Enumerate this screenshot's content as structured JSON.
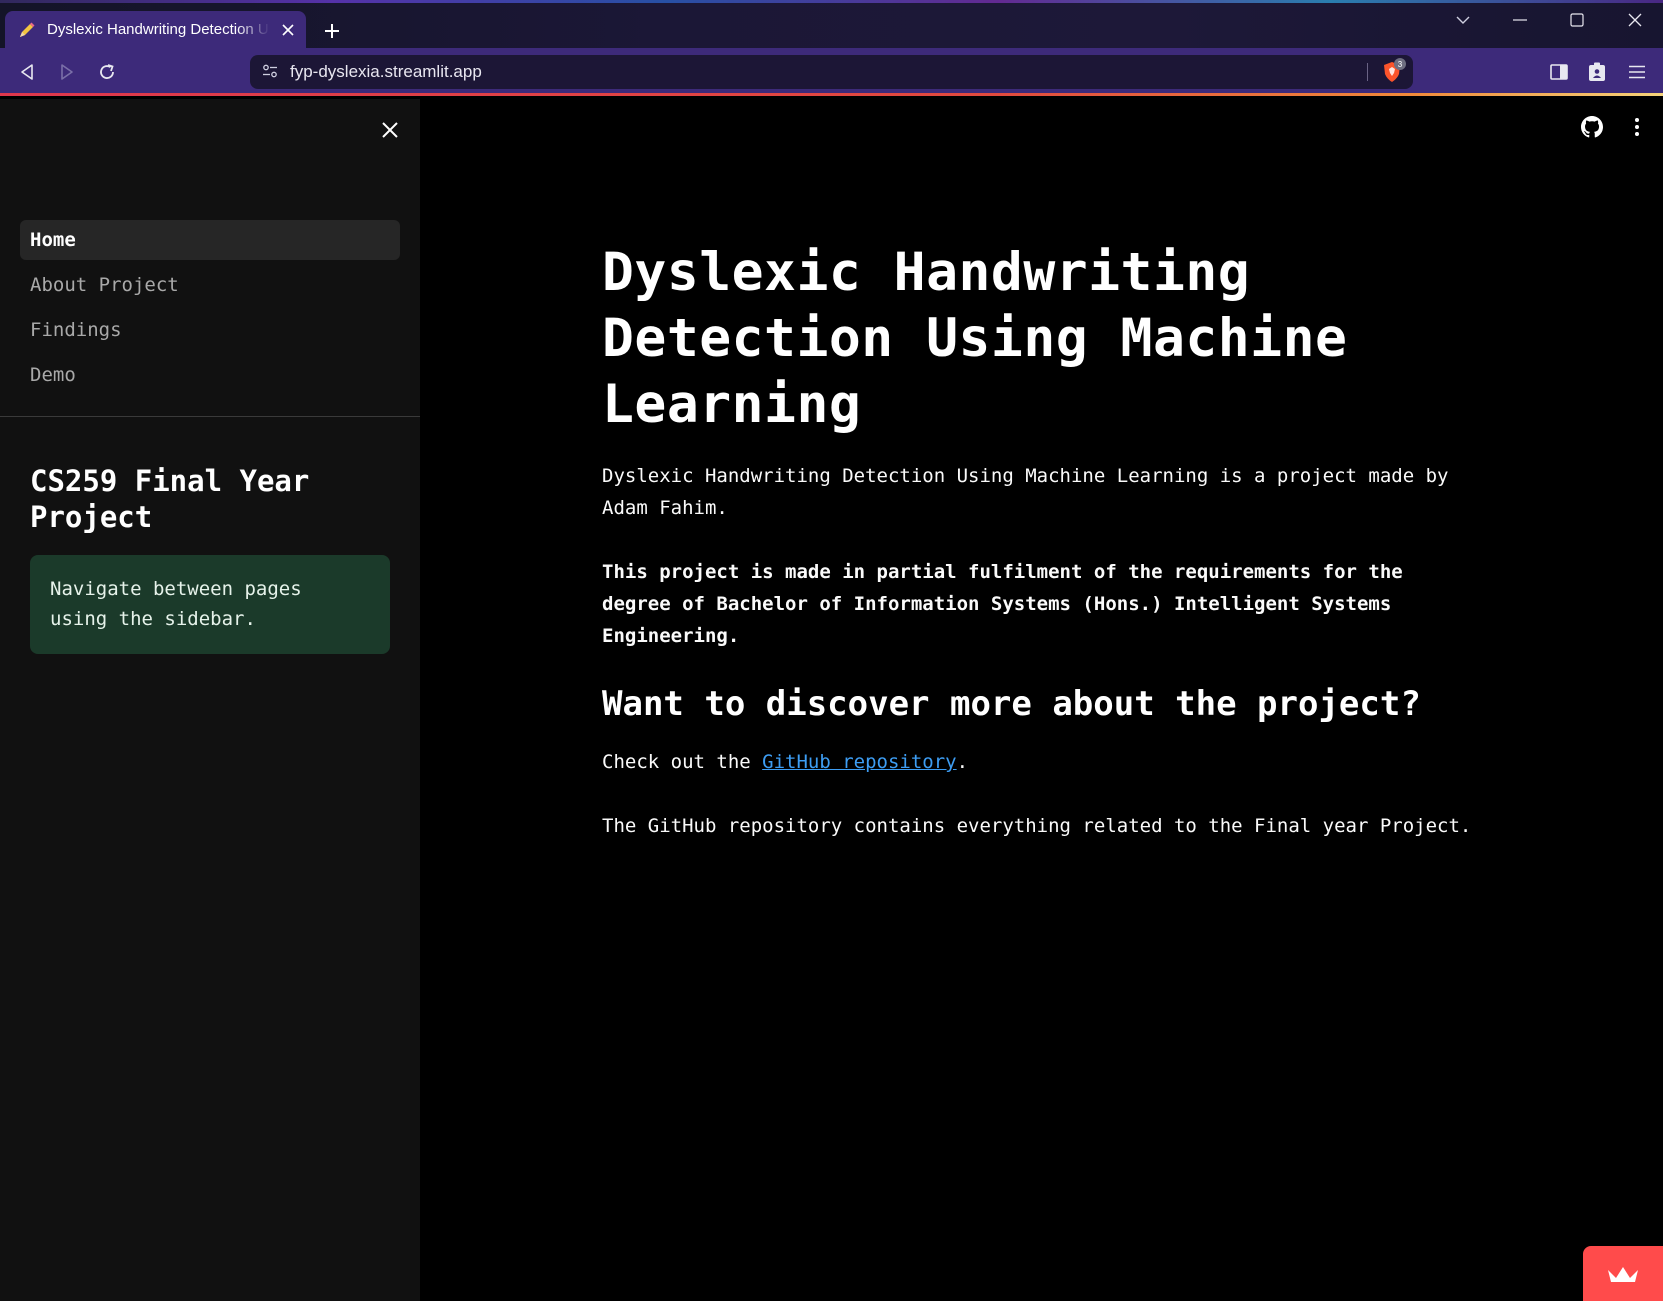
{
  "browser": {
    "tab_title": "Dyslexic Handwriting Detection Using Machine Learning",
    "url": "fyp-dyslexia.streamlit.app",
    "shield_count": "3"
  },
  "sidebar": {
    "nav_items": [
      {
        "label": "Home",
        "active": true
      },
      {
        "label": "About Project",
        "active": false
      },
      {
        "label": "Findings",
        "active": false
      },
      {
        "label": "Demo",
        "active": false
      }
    ],
    "heading": "CS259 Final Year Project",
    "info_text": "Navigate between pages using the sidebar."
  },
  "main": {
    "title": "Dyslexic Handwriting Detection Using Machine Learning",
    "intro": "Dyslexic Handwriting Detection Using Machine Learning is a project made by Adam Fahim.",
    "fulfilment": "This project is made in partial fulfilment of the requirements for the degree of Bachelor of Information Systems (Hons.) Intelligent Systems Engineering.",
    "subheading": "Want to discover more about the project?",
    "checkout_prefix": "Check out the ",
    "checkout_link": "GitHub repository",
    "checkout_suffix": ".",
    "repo_note": "The GitHub repository contains everything related to the Final year Project."
  },
  "colors": {
    "accent_link": "#3d9df3",
    "info_bg": "#1b3a2a",
    "streamlit_red": "#ff4b4b",
    "browser_purple": "#3d2a7a"
  }
}
